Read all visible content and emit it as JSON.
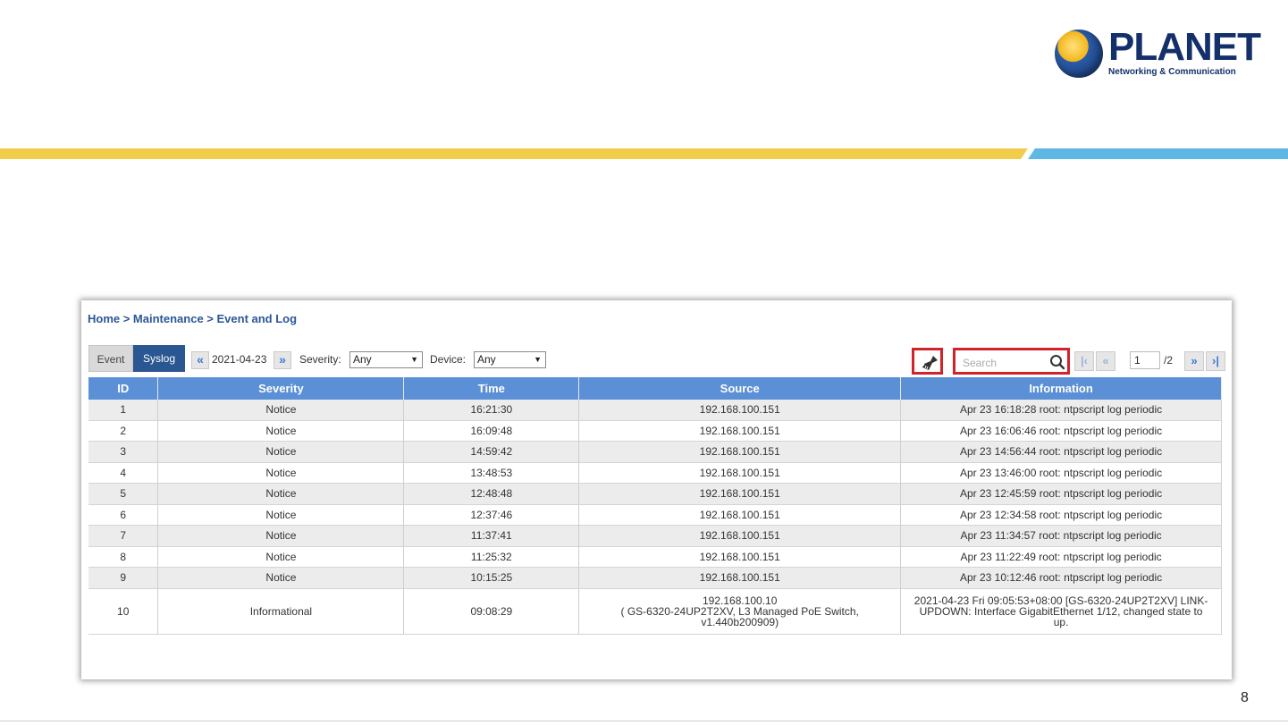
{
  "slide": {
    "brand": "PLANET",
    "tagline": "Networking & Communication",
    "page_number": "8",
    "colors": {
      "band_yellow": "#f2cd4b",
      "band_blue": "#5fb8e3",
      "brand_blue": "#13306b"
    }
  },
  "breadcrumb": "Home > Maintenance > Event and Log",
  "tabs": [
    {
      "label": "Event",
      "active": false
    },
    {
      "label": "Syslog",
      "active": true
    }
  ],
  "filters": {
    "prev_icon": "double-chevron-left-icon",
    "date": "2021-04-23",
    "next_icon": "double-chevron-right-icon",
    "severity_label": "Severity:",
    "severity_value": "Any",
    "device_label": "Device:",
    "device_value": "Any"
  },
  "actions": {
    "clean_icon": "broom-icon",
    "search_placeholder": "Search",
    "search_icon": "magnifier-icon"
  },
  "pagination": {
    "current": "1",
    "total": "/2"
  },
  "table": {
    "columns": [
      "ID",
      "Severity",
      "Time",
      "Source",
      "Information"
    ],
    "rows": [
      {
        "id": "1",
        "severity": "Notice",
        "time": "16:21:30",
        "source": "192.168.100.151",
        "info": "Apr 23 16:18:28 root: ntpscript log periodic"
      },
      {
        "id": "2",
        "severity": "Notice",
        "time": "16:09:48",
        "source": "192.168.100.151",
        "info": "Apr 23 16:06:46 root: ntpscript log periodic"
      },
      {
        "id": "3",
        "severity": "Notice",
        "time": "14:59:42",
        "source": "192.168.100.151",
        "info": "Apr 23 14:56:44 root: ntpscript log periodic"
      },
      {
        "id": "4",
        "severity": "Notice",
        "time": "13:48:53",
        "source": "192.168.100.151",
        "info": "Apr 23 13:46:00 root: ntpscript log periodic"
      },
      {
        "id": "5",
        "severity": "Notice",
        "time": "12:48:48",
        "source": "192.168.100.151",
        "info": "Apr 23 12:45:59 root: ntpscript log periodic"
      },
      {
        "id": "6",
        "severity": "Notice",
        "time": "12:37:46",
        "source": "192.168.100.151",
        "info": "Apr 23 12:34:58 root: ntpscript log periodic"
      },
      {
        "id": "7",
        "severity": "Notice",
        "time": "11:37:41",
        "source": "192.168.100.151",
        "info": "Apr 23 11:34:57 root: ntpscript log periodic"
      },
      {
        "id": "8",
        "severity": "Notice",
        "time": "11:25:32",
        "source": "192.168.100.151",
        "info": "Apr 23 11:22:49 root: ntpscript log periodic"
      },
      {
        "id": "9",
        "severity": "Notice",
        "time": "10:15:25",
        "source": "192.168.100.151",
        "info": "Apr 23 10:12:46 root: ntpscript log periodic"
      },
      {
        "id": "10",
        "severity": "Informational",
        "time": "09:08:29",
        "source_lines": [
          "192.168.100.10",
          "( GS-6320-24UP2T2XV, L3 Managed PoE Switch,",
          "v1.440b200909)"
        ],
        "info_lines": [
          "2021-04-23 Fri 09:05:53+08:00 [GS-6320-24UP2T2XV] LINK-",
          "UPDOWN: Interface GigabitEthernet 1/12, changed state to",
          "up."
        ]
      }
    ]
  }
}
